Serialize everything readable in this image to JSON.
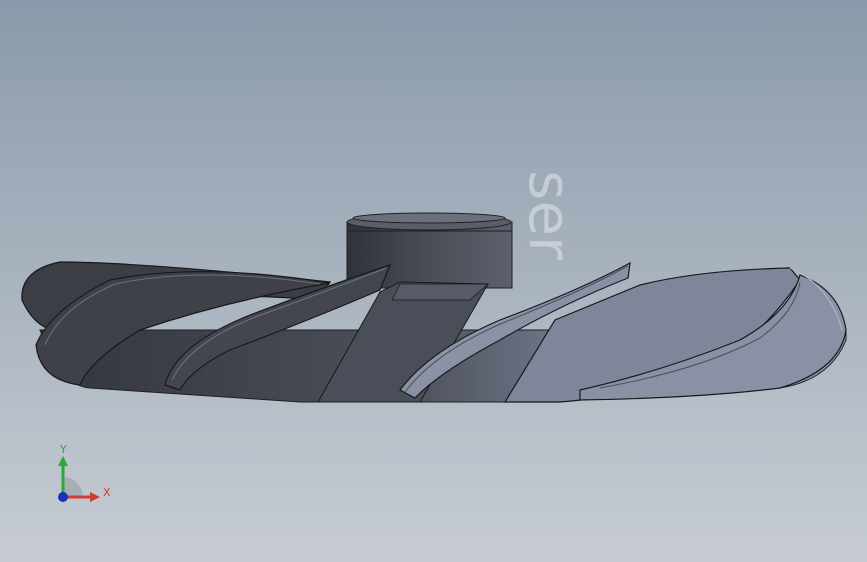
{
  "viewport": {
    "background_top": "#8a9aaa",
    "background_bottom": "#c7ccd3"
  },
  "model": {
    "description_icon": "impeller-3d-model",
    "body_color": "#3c3f46",
    "highlight_color": "#8c93a6"
  },
  "watermark": {
    "text": "ser"
  },
  "triad": {
    "y_label": "Y",
    "x_label": "X",
    "y_color": "#2aa83a",
    "x_color": "#d23a3a",
    "z_color": "#1c2fb8"
  }
}
